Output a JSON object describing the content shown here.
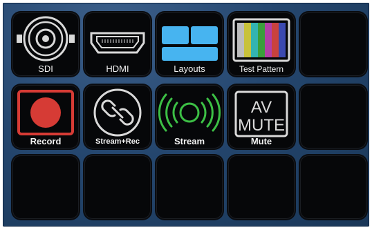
{
  "keys": [
    {
      "label": "SDI",
      "icon": "bnc-connector-icon"
    },
    {
      "label": "HDMI",
      "icon": "hdmi-port-icon"
    },
    {
      "label": "Layouts",
      "icon": "layouts-icon"
    },
    {
      "label": "Test Pattern",
      "icon": "color-bars-icon"
    },
    {
      "label": "",
      "icon": ""
    },
    {
      "label": "Record",
      "icon": "record-icon"
    },
    {
      "label": "Stream+Rec",
      "icon": "link-icon"
    },
    {
      "label": "Stream",
      "icon": "broadcast-icon"
    },
    {
      "label": "Mute",
      "icon": "av-mute-icon",
      "icon_text": [
        "AV",
        "MUTE"
      ]
    },
    {
      "label": "",
      "icon": ""
    },
    {
      "label": "",
      "icon": ""
    },
    {
      "label": "",
      "icon": ""
    },
    {
      "label": "",
      "icon": ""
    },
    {
      "label": "",
      "icon": ""
    },
    {
      "label": "",
      "icon": ""
    }
  ],
  "colors": {
    "layout_blue": "#47b4f0",
    "record_red": "#d63b35",
    "stream_green": "#3cbf45",
    "test_bars": [
      "#bdbdbd",
      "#c8c23a",
      "#33b4b1",
      "#3a9e3b",
      "#b23fa6",
      "#c9423d",
      "#3b49b0"
    ]
  }
}
